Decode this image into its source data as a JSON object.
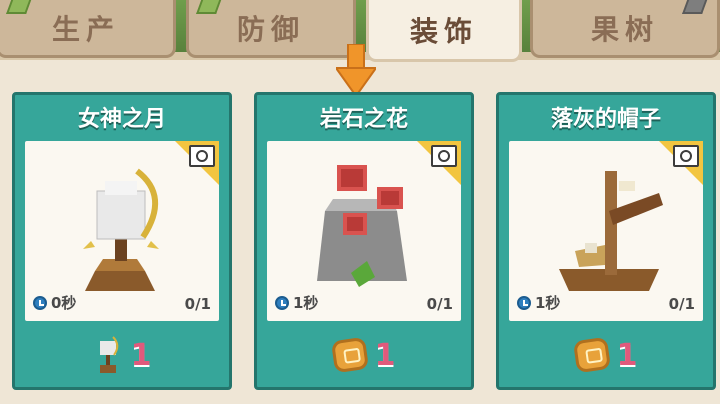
{
  "tabs": [
    {
      "label": "生产",
      "active": false
    },
    {
      "label": "防御",
      "active": false
    },
    {
      "label": "装饰",
      "active": true
    },
    {
      "label": "果树",
      "active": false
    }
  ],
  "cards": [
    {
      "title": "女神之月",
      "time": "0秒",
      "progress": "0/1",
      "cost": "1",
      "cost_icon": "moon-statue-icon"
    },
    {
      "title": "岩石之花",
      "time": "1秒",
      "progress": "0/1",
      "cost": "1",
      "cost_icon": "gold-coin-icon"
    },
    {
      "title": "落灰的帽子",
      "time": "1秒",
      "progress": "0/1",
      "cost": "1",
      "cost_icon": "gold-coin-icon"
    }
  ],
  "colors": {
    "card_bg": "#36a69a",
    "accent_arrow": "#f0952a",
    "cost_text": "#e05a7c",
    "corner_flag": "#f2c540"
  }
}
